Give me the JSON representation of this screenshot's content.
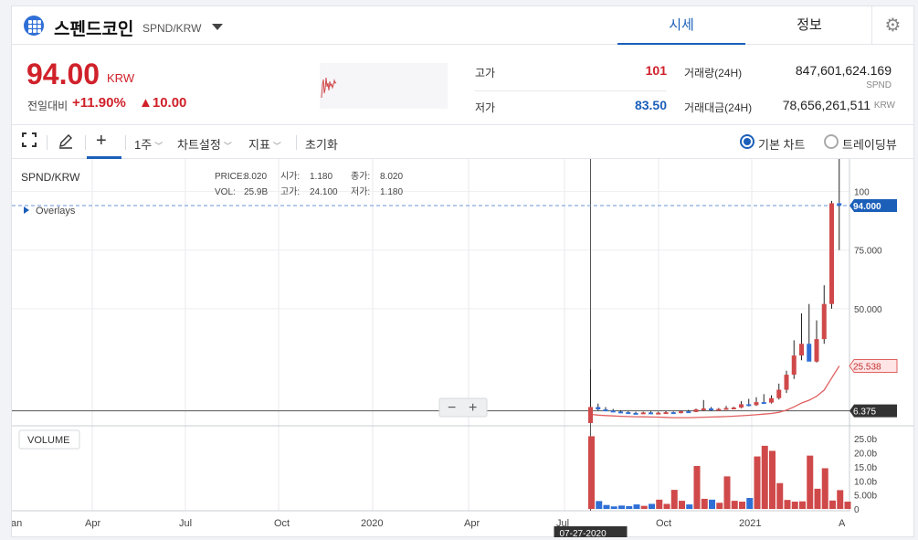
{
  "header": {
    "coin_name": "스펜드코인",
    "coin_symbol": "SPND/KRW",
    "tabs": [
      {
        "label": "시세",
        "active": true
      },
      {
        "label": "정보",
        "active": false
      }
    ],
    "settings_icon": "gear-icon"
  },
  "price": {
    "current": "94.00",
    "unit": "KRW",
    "change_label": "전일대비",
    "change_pct": "+11.90%",
    "change_abs": "▲10.00",
    "high_label": "고가",
    "high": "101",
    "low_label": "저가",
    "low": "83.50",
    "volume_label": "거래량(24H)",
    "volume": "847,601,624.169",
    "volume_unit": "SPND",
    "value_label": "거래대금(24H)",
    "value": "78,656,261,511",
    "value_unit": "KRW"
  },
  "toolbar": {
    "period": "1주",
    "chart_settings": "차트설정",
    "indicators": "지표",
    "reset": "초기화",
    "radio_basic": "기본 차트",
    "radio_trading": "트레이딩뷰"
  },
  "colors": {
    "up": "#d0494a",
    "down": "#2f6fd6",
    "accent": "#1b5fb9",
    "price_badge": "#1b5fb9",
    "ma_badge": "#e06060",
    "crosshair_badge": "#333333"
  },
  "chart_data": {
    "type": "candlestick",
    "pair": "SPND/KRW",
    "overlays_label": "Overlays",
    "volume_label": "VOLUME",
    "ohlc_legend": {
      "price_label": "PRICE:",
      "price": "8.020",
      "open_label": "시가:",
      "open": "1.180",
      "close_label": "종가:",
      "close": "8.020",
      "vol_label": "VOL:",
      "vol": "25.9B",
      "high_label": "고가:",
      "high": "24.100",
      "low_label": "저가:",
      "low": "1.180"
    },
    "x_tick_labels": [
      "an",
      "Apr",
      "Jul",
      "Oct",
      "2020",
      "Apr",
      "Jul",
      "Oct",
      "2021",
      "A"
    ],
    "crosshair_date": "07-27-2020",
    "price_axis": {
      "ticks": [
        100,
        75,
        50
      ],
      "tick_labels": [
        "100",
        "75.000",
        "50.000"
      ],
      "min": 0,
      "max": 110
    },
    "volume_axis": {
      "ticks": [
        25,
        20,
        15,
        10,
        5,
        0
      ],
      "tick_labels": [
        "25.0b",
        "20.0b",
        "15.0b",
        "10.0b",
        "5.00b",
        "0"
      ],
      "unit": "b",
      "max": 28
    },
    "current_price_label": "94.000",
    "current_price": 94,
    "ma_label": "25.538",
    "ma_value": 25.538,
    "crosshair_label": "6.375",
    "crosshair_value": 6.375,
    "series": [
      {
        "name": "candles",
        "ohlc": [
          [
            1.18,
            24.1,
            1.18,
            8.02
          ],
          [
            8.0,
            9.5,
            6.5,
            7.0
          ],
          [
            7.0,
            8.0,
            6.2,
            6.5
          ],
          [
            6.5,
            7.2,
            5.9,
            6.1
          ],
          [
            6.1,
            6.6,
            5.6,
            5.8
          ],
          [
            5.8,
            6.2,
            5.3,
            5.5
          ],
          [
            5.5,
            6.0,
            5.1,
            5.4
          ],
          [
            5.4,
            6.0,
            5.2,
            5.7
          ],
          [
            5.7,
            6.2,
            5.3,
            5.5
          ],
          [
            5.5,
            6.0,
            5.3,
            5.6
          ],
          [
            5.6,
            6.3,
            5.4,
            5.8
          ],
          [
            5.8,
            6.1,
            5.2,
            5.4
          ],
          [
            5.4,
            6.5,
            5.3,
            6.2
          ],
          [
            6.2,
            6.8,
            5.6,
            5.9
          ],
          [
            5.9,
            7.3,
            5.8,
            7.0
          ],
          [
            7.0,
            11.0,
            6.5,
            7.4
          ],
          [
            7.4,
            8.0,
            6.4,
            6.8
          ],
          [
            6.8,
            7.6,
            6.5,
            7.2
          ],
          [
            7.2,
            8.5,
            6.9,
            7.6
          ],
          [
            7.6,
            8.1,
            7.2,
            7.8
          ],
          [
            7.8,
            10.5,
            7.5,
            9.2
          ],
          [
            9.2,
            11.5,
            8.3,
            8.8
          ],
          [
            8.8,
            12.2,
            8.5,
            10.1
          ],
          [
            10.1,
            13.5,
            9.4,
            9.9
          ],
          [
            9.9,
            13.0,
            9.5,
            11.8
          ],
          [
            11.8,
            18.0,
            11.2,
            15.4
          ],
          [
            15.4,
            23.5,
            14.0,
            21.8
          ],
          [
            21.8,
            36.5,
            20.0,
            30.0
          ],
          [
            30.0,
            48.0,
            28.0,
            35.0
          ],
          [
            35.0,
            52.0,
            31.0,
            27.4
          ],
          [
            27.4,
            45.0,
            27.0,
            37.0
          ],
          [
            37.0,
            60.0,
            35.0,
            52.0
          ],
          [
            52.0,
            96.0,
            50.0,
            95.0
          ],
          [
            95.0,
            123.0,
            75.0,
            94.0
          ]
        ]
      },
      {
        "name": "volume",
        "values": [
          25.9,
          2.8,
          1.4,
          0.9,
          1.2,
          1.0,
          1.6,
          1.1,
          1.8,
          3.3,
          1.8,
          6.8,
          2.9,
          1.6,
          15.3,
          3.6,
          3.3,
          2.2,
          11.6,
          2.9,
          2.6,
          3.9,
          18.7,
          22.5,
          20.7,
          9.2,
          3.2,
          2.6,
          2.7,
          19.0,
          7.2,
          14.5,
          3.0,
          6.7,
          2.6
        ]
      }
    ]
  }
}
